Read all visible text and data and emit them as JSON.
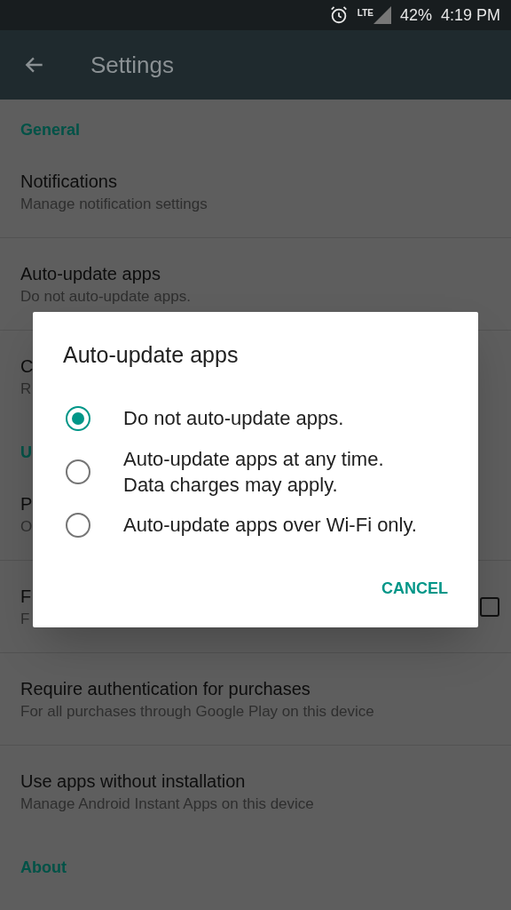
{
  "status_bar": {
    "network": "LTE",
    "battery": "42%",
    "time": "4:19 PM"
  },
  "toolbar": {
    "title": "Settings"
  },
  "list": [
    {
      "kind": "section",
      "title": "General"
    },
    {
      "kind": "item",
      "title": "Notifications",
      "subtitle": "Manage notification settings"
    },
    {
      "kind": "divider"
    },
    {
      "kind": "item",
      "title": "Auto-update apps",
      "subtitle": "Do not auto-update apps."
    },
    {
      "kind": "divider"
    },
    {
      "kind": "item",
      "title": "C",
      "subtitle": "R"
    },
    {
      "kind": "section",
      "title": "U"
    },
    {
      "kind": "item",
      "title": "P",
      "subtitle": "O"
    },
    {
      "kind": "divider"
    },
    {
      "kind": "check",
      "title": "F",
      "subtitle": "F",
      "checked": false
    },
    {
      "kind": "divider"
    },
    {
      "kind": "item",
      "title": "Require authentication for purchases",
      "subtitle": "For all purchases through Google Play on this device"
    },
    {
      "kind": "divider"
    },
    {
      "kind": "item",
      "title": "Use apps without installation",
      "subtitle": "Manage Android Instant Apps on this device"
    },
    {
      "kind": "section",
      "title": "About"
    }
  ],
  "dialog": {
    "title": "Auto-update apps",
    "options": [
      {
        "label": "Do not auto-update apps.",
        "selected": true
      },
      {
        "label": "Auto-update apps at any time. Data charges may apply.",
        "selected": false
      },
      {
        "label": "Auto-update apps over Wi-Fi only.",
        "selected": false
      }
    ],
    "cancel": "CANCEL"
  }
}
